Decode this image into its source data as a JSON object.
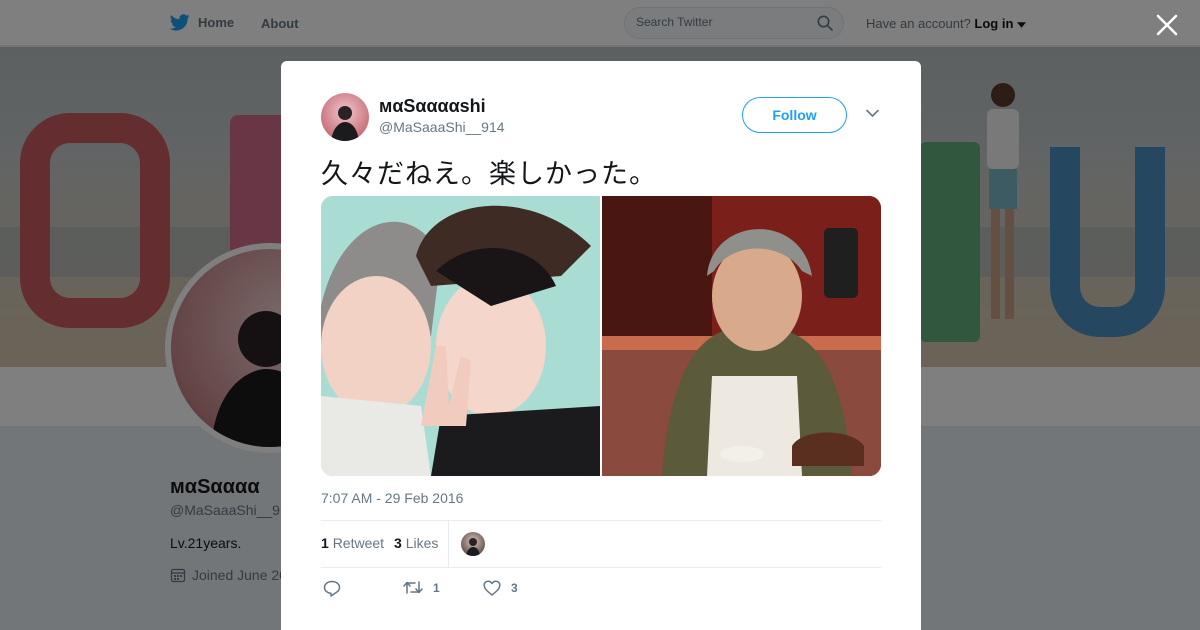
{
  "colors": {
    "brand_blue": "#1da1f2",
    "text_primary": "#14171a",
    "text_secondary": "#657786",
    "overlay": "rgba(0,0,0,0.5)"
  },
  "nav": {
    "home_label": "Home",
    "about_label": "About",
    "search_placeholder": "Search Twitter",
    "account_prompt": "Have an account?",
    "login_label": "Log in",
    "icons": [
      "twitter-bird-icon",
      "search-icon",
      "caret-down-icon",
      "close-icon"
    ]
  },
  "profile": {
    "name": "мαSαααα",
    "handle": "@MaSaaaShi__9",
    "bio": "Lv.21years.",
    "joined": "Joined June 20"
  },
  "tweet": {
    "display_name": "мαSααααshi",
    "handle": "@MaSaaaShi__914",
    "follow_label": "Follow",
    "text": "久々だねえ。楽しかった。",
    "timestamp": "7:07 AM - 29 Feb 2016",
    "retweet_count": "1",
    "retweet_label": "Retweet",
    "like_count": "3",
    "like_label": "Likes",
    "actions": {
      "reply_icon": "reply-icon",
      "retweet_icon": "retweet-icon",
      "retweet_count": "1",
      "like_icon": "heart-icon",
      "like_count": "3"
    },
    "photos": [
      "photo-1",
      "photo-2"
    ]
  }
}
